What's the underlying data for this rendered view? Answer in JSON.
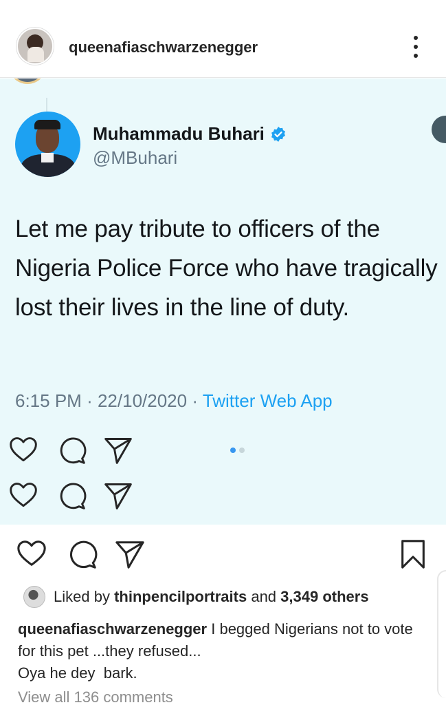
{
  "header": {
    "username": "queenafiaschwarzenegger"
  },
  "tweet": {
    "author_name": "Muhammadu Buhari",
    "author_handle": "@MBuhari",
    "text": "Let me pay tribute to officers of the Nigeria Police Force who have tragically lost their lives in the line of duty.",
    "time": "6:15 PM",
    "separator": "·",
    "date": "22/10/2020",
    "source": "Twitter Web App"
  },
  "carousel": {
    "current": 1,
    "total": 2
  },
  "post": {
    "liked_by_prefix": "Liked by",
    "liked_by_user": "thinpencilportraits",
    "liked_by_and": "and",
    "liked_by_others": "3,349 others",
    "caption_user": "queenafiaschwarzenegger",
    "caption_line1": "I begged Nigerians not to vote for this pet ...they refused...",
    "caption_line2": "Oya he dey  bark.",
    "view_comments": "View all 136 comments"
  },
  "colors": {
    "tweet_bg": "#eaf9fb",
    "twitter_blue": "#1da1f2",
    "text_primary": "#14171a",
    "text_secondary": "#657786",
    "ig_text": "#262626",
    "ig_muted": "#8e8e8e"
  },
  "icons": [
    "heart-icon",
    "comment-icon",
    "send-icon",
    "bookmark-icon",
    "more-options-icon",
    "verified-badge-icon"
  ]
}
